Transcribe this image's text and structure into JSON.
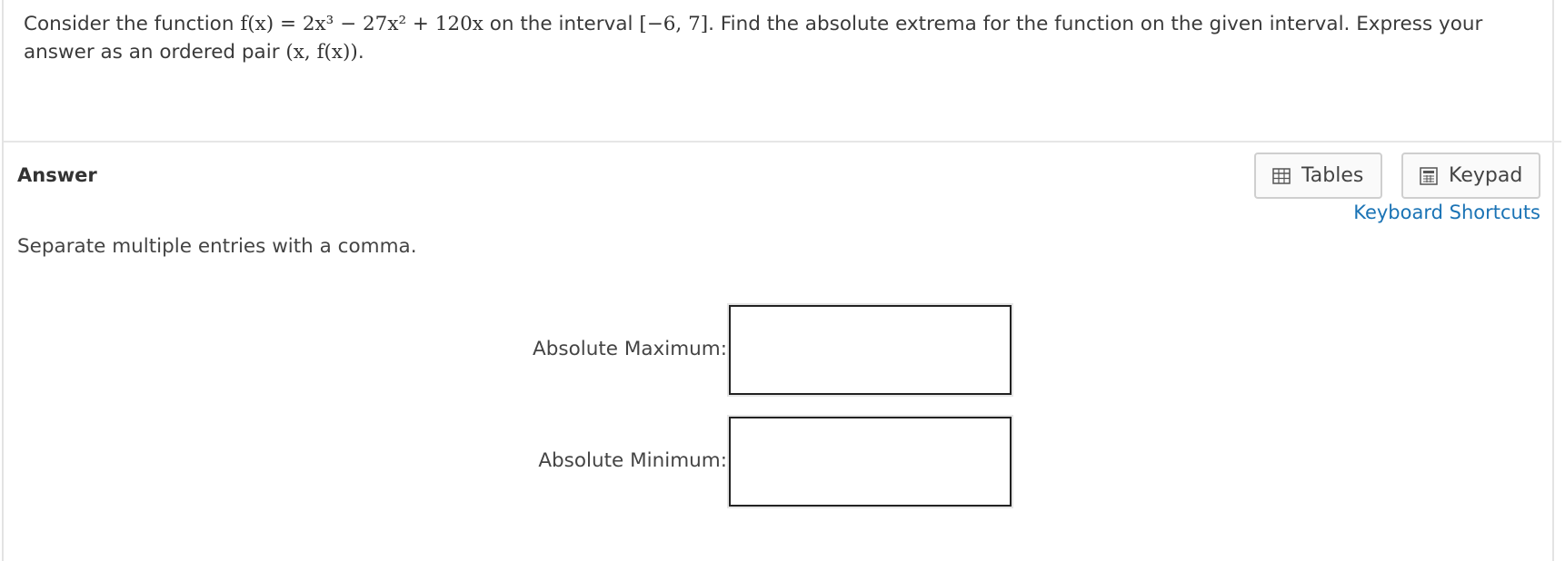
{
  "question": {
    "prefix": "Consider the function",
    "math_func": "f(x) = 2x³ − 27x² + 120x",
    "mid": "on the interval",
    "math_interval": "[−6, 7]",
    "suffix": ". Find the absolute extrema for the function on the given interval. Express your answer as an ordered pair",
    "math_pair": "(x, f(x))",
    "end": "."
  },
  "answer": {
    "title": "Answer",
    "instructions": "Separate multiple entries with a comma."
  },
  "tools": {
    "tables_label": "Tables",
    "tables_icon": "table-grid-icon",
    "keypad_label": "Keypad",
    "keypad_icon": "calculator-icon",
    "shortcuts_label": "Keyboard Shortcuts",
    "link_color": "#1a73b5"
  },
  "fields": {
    "max_label": "Absolute Maximum:",
    "max_value": "",
    "min_label": "Absolute Minimum:",
    "min_value": ""
  }
}
